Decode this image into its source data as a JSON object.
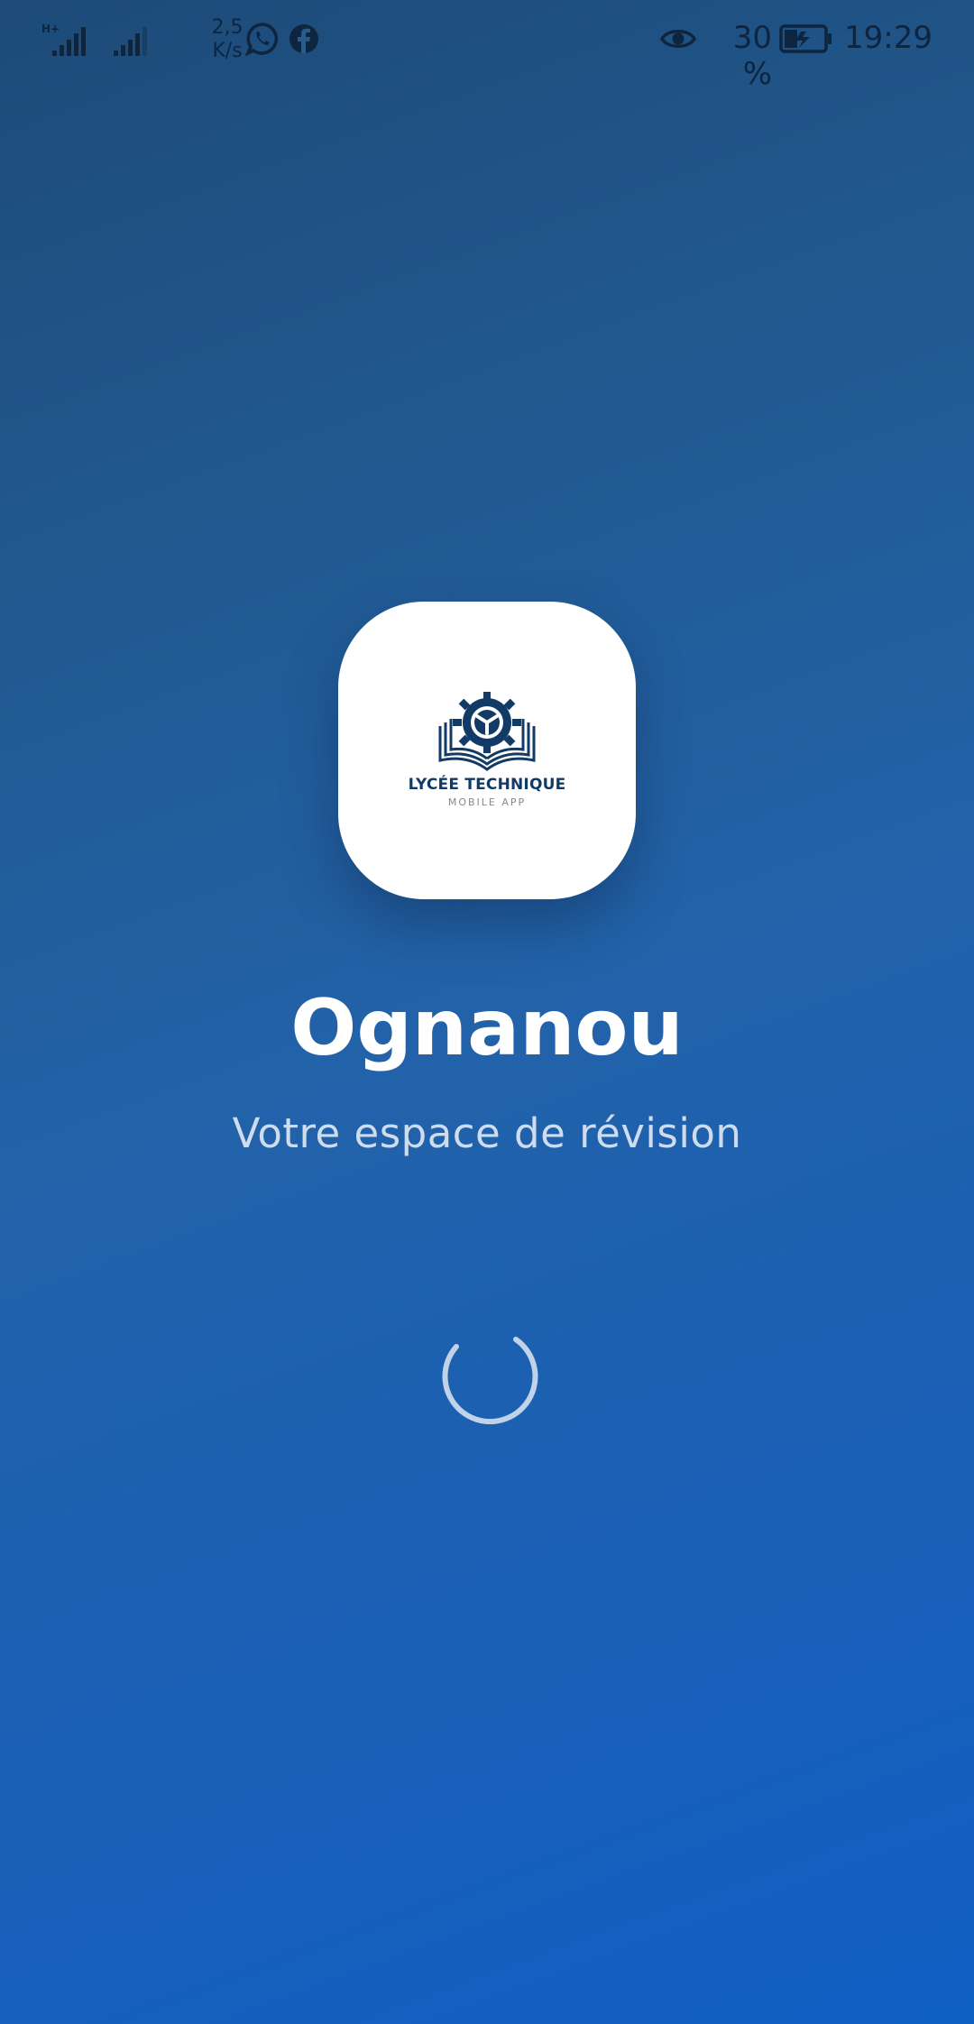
{
  "status_bar": {
    "network_type": "H+",
    "net_speed_value": "2,5",
    "net_speed_unit": "K/s",
    "notification_icons": [
      "whatsapp-icon",
      "facebook-icon"
    ],
    "eye_comfort_icon": "eye-icon",
    "battery_percent": "30 %",
    "battery_charging": true,
    "time": "19:29"
  },
  "splash": {
    "logo_title": "LYCÉE TECHNIQUE",
    "logo_subtitle": "MOBILE APP",
    "app_name": "Ognanou",
    "tagline": "Votre espace de révision"
  },
  "colors": {
    "background_top": "#1d4a78",
    "background_bottom": "#105fc4",
    "logo_blue": "#123a66"
  }
}
